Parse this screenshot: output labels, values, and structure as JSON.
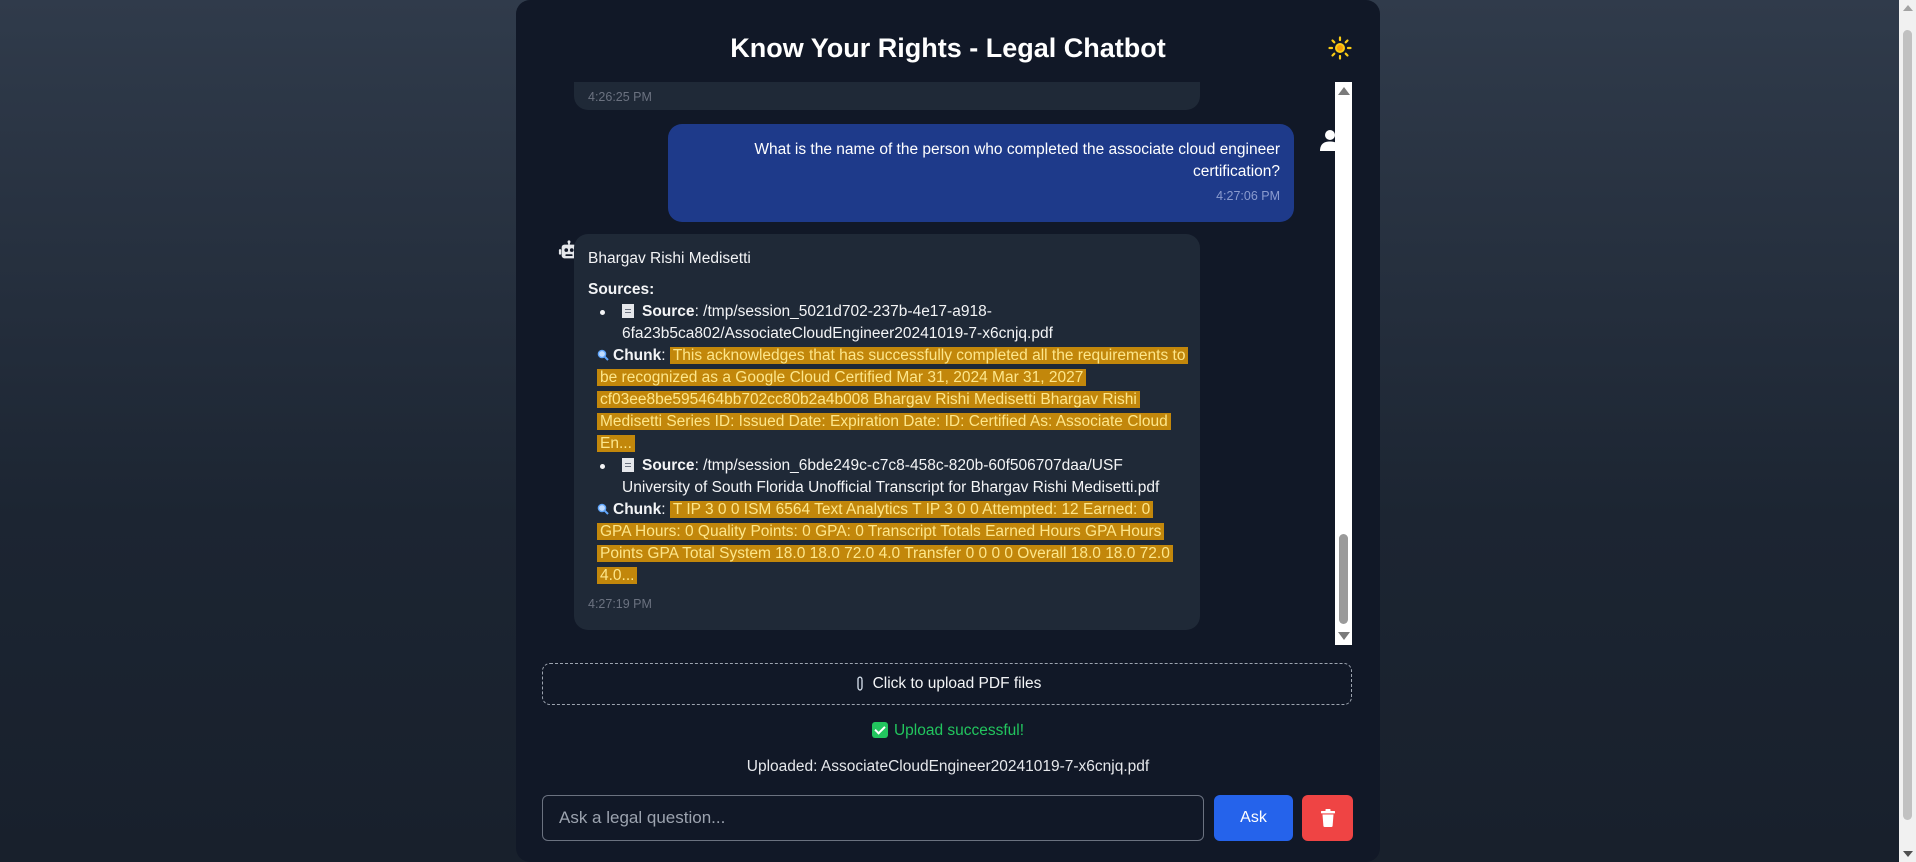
{
  "app": {
    "title": "Know Your Rights - Legal Chatbot"
  },
  "colors": {
    "accent": "#2563eb",
    "danger": "#ef4444",
    "success": "#22c55e",
    "user_bubble": "#1e3a8a",
    "bot_bubble": "#1f2937",
    "highlight": "#c2870b",
    "sun": "#facc15"
  },
  "icons": {
    "theme_toggle": "sun-icon",
    "user_avatar": "user-icon",
    "bot_avatar": "robot-icon",
    "source_doc": "document-icon",
    "chunk": "magnifier-icon",
    "upload": "paperclip-icon",
    "status": "check-icon",
    "clear": "trash-icon"
  },
  "chat": {
    "previous": {
      "timestamp": "4:26:25 PM"
    },
    "user_message": {
      "text": "What is the name of the person who completed the associate cloud engineer certification?",
      "timestamp": "4:27:06 PM"
    },
    "bot_message": {
      "answer": "Bhargav Rishi Medisetti",
      "sources_label": "Sources:",
      "source_label": "Source",
      "chunk_label": "Chunk",
      "sources": [
        {
          "path": ": /tmp/session_5021d702-237b-4e17-a918-6fa23b5ca802/AssociateCloudEngineer20241019-7-x6cnjq.pdf",
          "chunk": "This acknowledges that has successfully completed all the requirements to be recognized as a Google Cloud Certified Mar 31, 2024 Mar 31, 2027 cf03ee8be595464bb702cc80b2a4b008 Bhargav Rishi Medisetti Bhargav Rishi Medisetti Series ID: Issued Date: Expiration Date: ID: Certified As: Associate Cloud En..."
        },
        {
          "path": ": /tmp/session_6bde249c-c7c8-458c-820b-60f506707daa/USF University of South Florida Unofficial Transcript for Bhargav Rishi Medisetti.pdf",
          "chunk": "T IP 3 0 0 ISM 6564 Text Analytics T IP 3 0 0 Attempted: 12 Earned: 0 GPA Hours: 0 Quality Points: 0 GPA: 0 Transcript Totals Earned Hours GPA Hours Points GPA Total System 18.0 18.0 72.0 4.0 Transfer 0 0 0 0 Overall 18.0 18.0 72.0 4.0..."
        }
      ],
      "timestamp": "4:27:19 PM"
    }
  },
  "upload": {
    "label": "Click to upload PDF files",
    "status": "Upload successful!",
    "uploaded_text": "Uploaded: AssociateCloudEngineer20241019-7-x6cnjq.pdf"
  },
  "input": {
    "placeholder": "Ask a legal question...",
    "value": ""
  },
  "buttons": {
    "ask": "Ask"
  }
}
